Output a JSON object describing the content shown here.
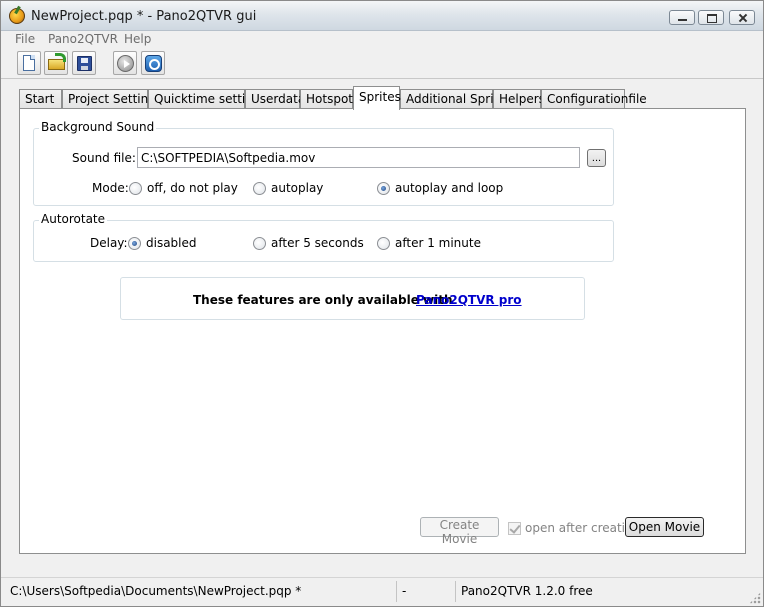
{
  "window": {
    "title": "NewProject.pqp * - Pano2QTVR gui"
  },
  "menu": {
    "file": "File",
    "pano2qtvr": "Pano2QTVR",
    "help": "Help"
  },
  "tabs": [
    {
      "label": "Start"
    },
    {
      "label": "Project Settings"
    },
    {
      "label": "Quicktime settings"
    },
    {
      "label": "Userdata"
    },
    {
      "label": "Hotspots"
    },
    {
      "label": "Sprites",
      "active": true
    },
    {
      "label": "Additional Sprites"
    },
    {
      "label": "Helpers"
    },
    {
      "label": "Configurationfile"
    }
  ],
  "background_sound": {
    "group_label": "Background Sound",
    "sound_file_label": "Sound file:",
    "sound_file_value": "C:\\SOFTPEDIA\\Softpedia.mov",
    "browse_label": "...",
    "mode_label": "Mode:",
    "mode_options": [
      "off, do not play",
      "autoplay",
      "autoplay and loop"
    ],
    "mode_selected": "autoplay and loop"
  },
  "autorotate": {
    "group_label": "Autorotate",
    "delay_label": "Delay:",
    "delay_options": [
      "disabled",
      "after 5 seconds",
      "after 1 minute"
    ],
    "delay_selected": "disabled"
  },
  "pro_notice": {
    "text": "These features are only available with",
    "link": "Pano2QTVR pro"
  },
  "actions": {
    "create_movie": "Create Movie",
    "open_after_creation": "open after creation",
    "open_after_creation_checked": true,
    "open_movie": "Open Movie"
  },
  "statusbar": {
    "path": "C:\\Users\\Softpedia\\Documents\\NewProject.pqp *",
    "middle": "-",
    "version": "Pano2QTVR 1.2.0 free"
  }
}
